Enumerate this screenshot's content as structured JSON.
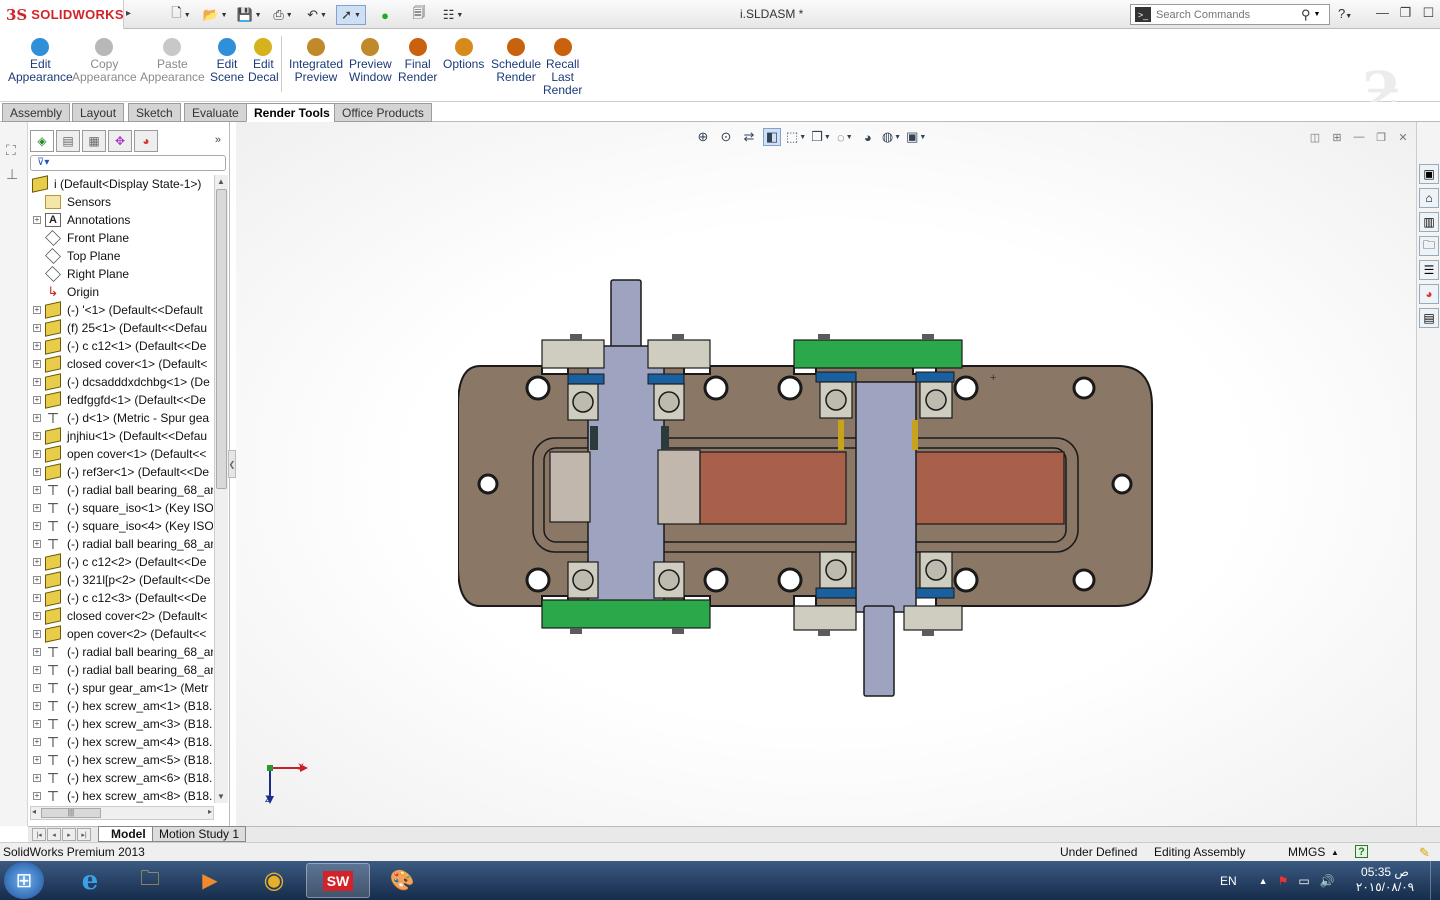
{
  "app": {
    "logo_ds": "3S",
    "logo_text": "SOLIDWORKS",
    "doc_title": "i.SLDASM *"
  },
  "search": {
    "placeholder": "Search Commands"
  },
  "ribbon": {
    "buttons": [
      {
        "line1": "Edit",
        "line2": "Appearance",
        "line3": "",
        "enabled": true,
        "color": "#2f8fd8"
      },
      {
        "line1": "Copy",
        "line2": "Appearance",
        "line3": "",
        "enabled": false,
        "color": "#b8b8b8"
      },
      {
        "line1": "Paste",
        "line2": "Appearance",
        "line3": "",
        "enabled": false,
        "color": "#c8c8c8"
      },
      {
        "line1": "Edit",
        "line2": "Scene",
        "line3": "",
        "enabled": true,
        "color": "#2f8fd8"
      },
      {
        "line1": "Edit",
        "line2": "Decal",
        "line3": "",
        "enabled": true,
        "color": "#d6b21c"
      },
      {
        "line1": "Integrated",
        "line2": "Preview",
        "line3": "",
        "enabled": true,
        "color": "#c0892a"
      },
      {
        "line1": "Preview",
        "line2": "Window",
        "line3": "",
        "enabled": true,
        "color": "#c0892a"
      },
      {
        "line1": "Final",
        "line2": "Render",
        "line3": "",
        "enabled": true,
        "color": "#c8620e"
      },
      {
        "line1": "Options",
        "line2": "",
        "line3": "",
        "enabled": true,
        "color": "#d68a1a"
      },
      {
        "line1": "Schedule",
        "line2": "Render",
        "line3": "",
        "enabled": true,
        "color": "#c8620e"
      },
      {
        "line1": "Recall",
        "line2": "Last",
        "line3": "Render",
        "enabled": true,
        "color": "#c8620e"
      }
    ]
  },
  "tabs": [
    "Assembly",
    "Layout",
    "Sketch",
    "Evaluate",
    "Render Tools",
    "Office Products"
  ],
  "active_tab": "Render Tools",
  "tree": {
    "root": "i  (Default<Display State-1>)",
    "items": [
      {
        "label": "Sensors",
        "icon": "folder-icon",
        "expand": false
      },
      {
        "label": "Annotations",
        "icon": "annotation-icon",
        "expand": true
      },
      {
        "label": "Front Plane",
        "icon": "plane-icon",
        "expand": false
      },
      {
        "label": "Top Plane",
        "icon": "plane-icon",
        "expand": false
      },
      {
        "label": "Right Plane",
        "icon": "plane-icon",
        "expand": false
      },
      {
        "label": "Origin",
        "icon": "origin-icon",
        "expand": false
      },
      {
        "label": "(-) '<1> (Default<<Default",
        "icon": "part-icon",
        "expand": true
      },
      {
        "label": "(f) 25<1> (Default<<Defau",
        "icon": "part-icon",
        "expand": true
      },
      {
        "label": "(-) c c12<1> (Default<<De",
        "icon": "part-icon",
        "expand": true
      },
      {
        "label": "closed cover<1> (Default<",
        "icon": "part-icon",
        "expand": true
      },
      {
        "label": "(-) dcsadddxdchbg<1> (De",
        "icon": "part-icon",
        "expand": true
      },
      {
        "label": "fedfggfd<1> (Default<<De",
        "icon": "part-icon",
        "expand": true
      },
      {
        "label": "(-) d<1> (Metric - Spur gea",
        "icon": "screw-icon",
        "expand": true
      },
      {
        "label": "jnjhiu<1> (Default<<Defau",
        "icon": "part-icon",
        "expand": true
      },
      {
        "label": "open cover<1> (Default<<",
        "icon": "part-icon",
        "expand": true
      },
      {
        "label": "(-) ref3er<1> (Default<<De",
        "icon": "part-icon",
        "expand": true
      },
      {
        "label": "(-) radial ball bearing_68_ar",
        "icon": "screw-icon",
        "expand": true
      },
      {
        "label": "(-) square_iso<1> (Key ISO",
        "icon": "screw-icon",
        "expand": true
      },
      {
        "label": "(-) square_iso<4> (Key ISO",
        "icon": "screw-icon",
        "expand": true
      },
      {
        "label": "(-) radial ball bearing_68_ar",
        "icon": "screw-icon",
        "expand": true
      },
      {
        "label": "(-) c c12<2> (Default<<De",
        "icon": "part-icon",
        "expand": true
      },
      {
        "label": "(-) 321l[p<2> (Default<<De",
        "icon": "part-icon",
        "expand": true
      },
      {
        "label": "(-) c c12<3> (Default<<De",
        "icon": "part-icon",
        "expand": true
      },
      {
        "label": "closed cover<2> (Default<",
        "icon": "part-icon",
        "expand": true
      },
      {
        "label": "open cover<2> (Default<<",
        "icon": "part-icon",
        "expand": true
      },
      {
        "label": "(-) radial ball bearing_68_ar",
        "icon": "screw-icon",
        "expand": true
      },
      {
        "label": "(-) radial ball bearing_68_ar",
        "icon": "screw-icon",
        "expand": true
      },
      {
        "label": "(-) spur gear_am<1> (Metr",
        "icon": "screw-icon",
        "expand": true
      },
      {
        "label": "(-) hex screw_am<1> (B18.",
        "icon": "screw-icon",
        "expand": true
      },
      {
        "label": "(-) hex screw_am<3> (B18.",
        "icon": "screw-icon",
        "expand": true
      },
      {
        "label": "(-) hex screw_am<4> (B18.",
        "icon": "screw-icon",
        "expand": true
      },
      {
        "label": "(-) hex screw_am<5> (B18.",
        "icon": "screw-icon",
        "expand": true
      },
      {
        "label": "(-) hex screw_am<6> (B18.",
        "icon": "screw-icon",
        "expand": true
      },
      {
        "label": "(-) hex screw_am<8> (B18.",
        "icon": "screw-icon",
        "expand": true
      }
    ]
  },
  "bottom_tabs": {
    "model": "Model",
    "motion": "Motion Study 1"
  },
  "triad": {
    "x": "X",
    "z": "Z"
  },
  "status": {
    "product": "SolidWorks Premium 2013",
    "state": "Under Defined",
    "mode": "Editing Assembly",
    "units": "MMGS",
    "units_arrow": "▲",
    "help": "?"
  },
  "taskbar": {
    "lang": "EN",
    "time": "05:35 ص",
    "date": "٢٠١٥/٠٨/٠٩"
  },
  "colors": {
    "housing": "#8a7766",
    "shaft": "#9ea4c0",
    "gear": "#a8604a",
    "cover_green": "#2aa84a",
    "seal_blue": "#1a5f9e"
  }
}
